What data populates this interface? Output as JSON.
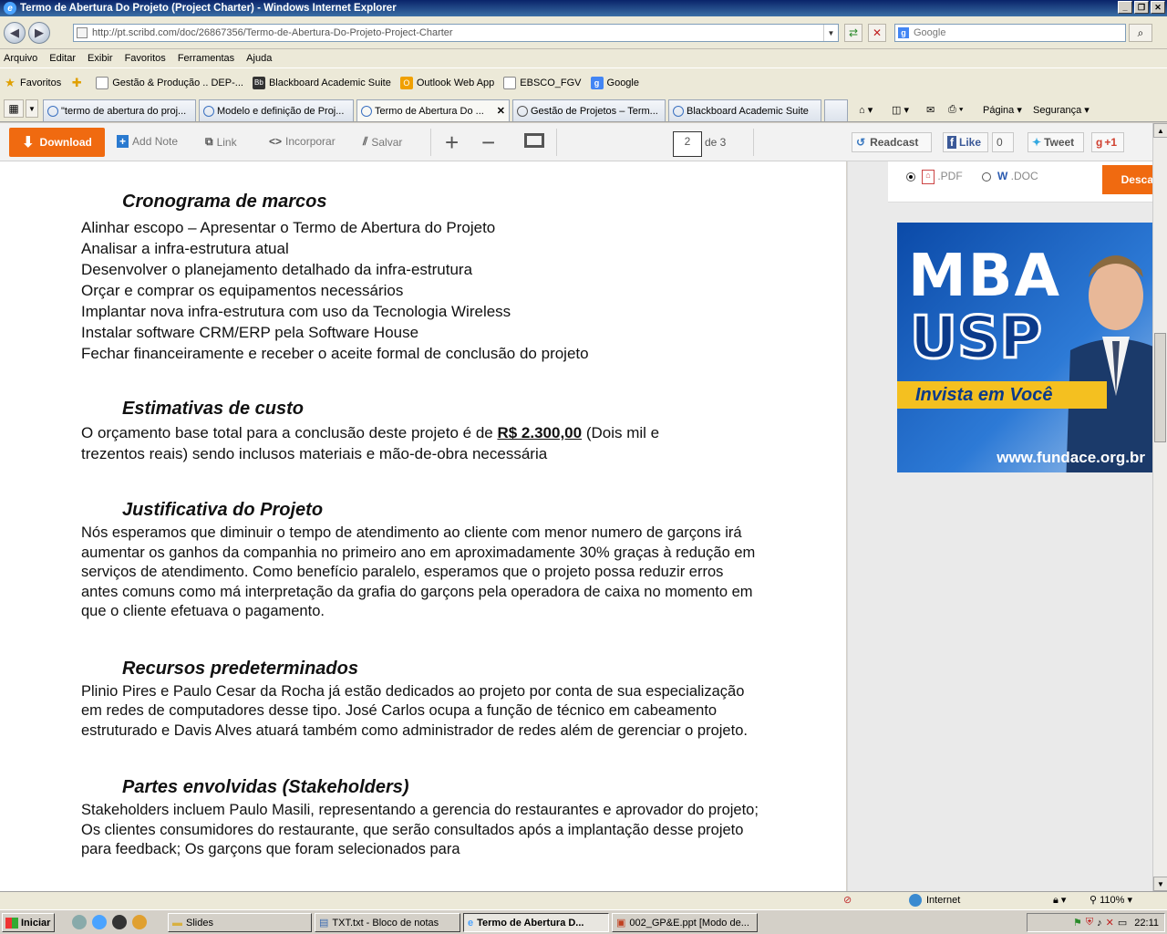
{
  "window": {
    "title": "Termo de Abertura Do Projeto (Project Charter) - Windows Internet Explorer"
  },
  "address": {
    "url": "http://pt.scribd.com/doc/26867356/Termo-de-Abertura-Do-Projeto-Project-Charter",
    "search_placeholder": "Google"
  },
  "menu": [
    "Arquivo",
    "Editar",
    "Exibir",
    "Favoritos",
    "Ferramentas",
    "Ajuda"
  ],
  "favorites": {
    "label": "Favoritos",
    "items": [
      "Gestão & Produção .. DEP-...",
      "Blackboard Academic Suite",
      "Outlook Web App",
      "EBSCO_FGV",
      "Google"
    ]
  },
  "tabs": [
    "\"termo de abertura do proj...",
    "Modelo e definição de Proj...",
    "Termo de Abertura Do ...",
    "Gestão de Projetos – Term...",
    "Blackboard Academic Suite"
  ],
  "command_bar": {
    "page": "Página",
    "security": "Segurança"
  },
  "scribd": {
    "download": "Download",
    "add_note": "Add Note",
    "link": "Link",
    "embed": "Incorporar",
    "save": "Salvar",
    "page_current": "2",
    "page_of": "de 3",
    "readcast": "Readcast",
    "like": "Like",
    "like_count": "0",
    "tweet": "Tweet",
    "plus_one": "+1"
  },
  "document": {
    "sections": [
      {
        "heading": "Cronograma de marcos",
        "lines": [
          "Alinhar escopo – Apresentar o Termo de Abertura do Projeto",
          "Analisar a infra-estrutura atual",
          "Desenvolver o planejamento detalhado da infra-estrutura",
          "Orçar e comprar os equipamentos necessários",
          "Implantar nova infra-estrutura com uso da Tecnologia Wireless",
          "Instalar software CRM/ERP pela Software House",
          "Fechar financeiramente e receber o aceite formal de conclusão do projeto"
        ]
      },
      {
        "heading": "Estimativas de custo",
        "text_before": "O orçamento base total para a conclusão deste projeto é de ",
        "money": "R$ 2.300,00",
        "text_after": " (Dois mil e trezentos reais) sendo inclusos materiais e mão-de-obra necessária"
      },
      {
        "heading": "Justificativa do Projeto",
        "text": "Nós esperamos que diminuir o tempo de atendimento ao cliente com menor numero de garçons irá aumentar os ganhos da companhia no primeiro ano em aproximadamente 30% graças à redução em serviços de atendimento. Como benefício paralelo, esperamos que o projeto possa reduzir erros antes comuns como má interpretação da grafia do garçons pela operadora de caixa no momento em que o cliente efetuava o pagamento."
      },
      {
        "heading": "Recursos predeterminados",
        "text": "Plinio Pires e Paulo Cesar da Rocha já estão dedicados ao projeto por conta de sua especialização em redes de computadores desse tipo. José Carlos ocupa a função de técnico em cabeamento estruturado e Davis Alves atuará também como administrador de redes além de gerenciar o projeto."
      },
      {
        "heading": "Partes envolvidas (Stakeholders)",
        "text": "Stakeholders incluem Paulo Masili, representando a gerencia do restaurantes e aprovador do projeto; Os clientes consumidores do restaurante, que serão consultados após a implantação desse projeto para feedback; Os garçons que foram selecionados para"
      }
    ]
  },
  "sidebar": {
    "format_pdf": ".PDF",
    "format_doc": ".DOC",
    "download_button": "Descargar",
    "ad": {
      "title": "MBA",
      "brand": "USP",
      "slogan": "Invista em Você",
      "url": "www.fundace.org.br"
    }
  },
  "status": {
    "zone": "Internet",
    "zoom": "110%"
  },
  "taskbar": {
    "start": "Iniciar",
    "tasks": [
      "Slides",
      "TXT.txt - Bloco de notas",
      "Termo de Abertura D...",
      "002_GP&E.ppt [Modo de..."
    ],
    "clock": "22:11"
  }
}
